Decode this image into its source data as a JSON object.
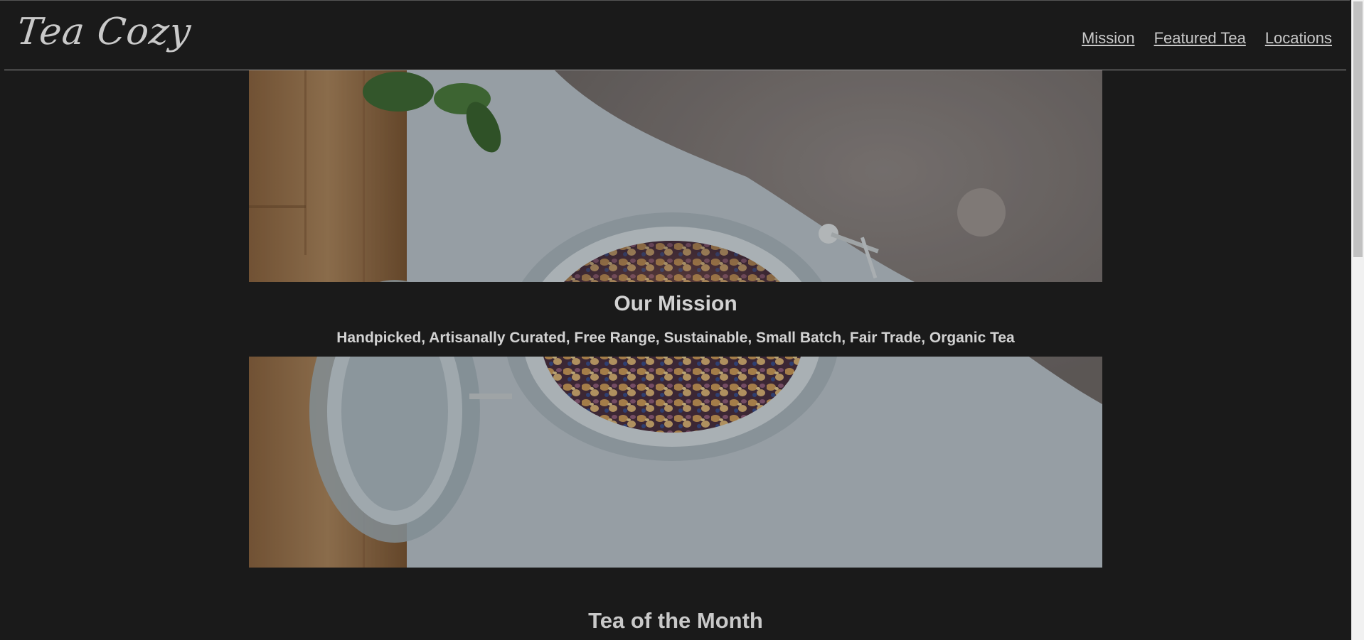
{
  "brand": {
    "logo_text": "Tea Cozy"
  },
  "nav": {
    "items": [
      {
        "label": "Mission"
      },
      {
        "label": "Featured Tea"
      },
      {
        "label": "Locations"
      }
    ]
  },
  "mission": {
    "title": "Our Mission",
    "subtitle": "Handpicked, Artisanally Curated, Free Range, Sustainable, Small Batch, Fair Trade, Organic Tea"
  },
  "featured": {
    "title": "Tea of the Month"
  },
  "colors": {
    "background": "#1a1a1a",
    "text": "#d2d2d2",
    "rule": "#9a9a9a"
  }
}
